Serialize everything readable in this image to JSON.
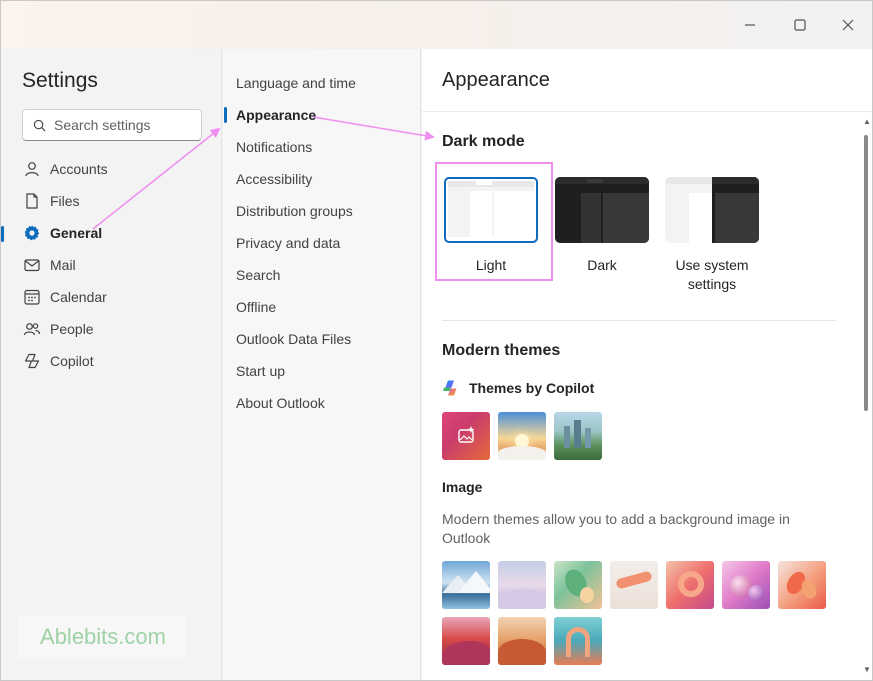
{
  "window": {
    "controls": [
      "minimize",
      "maximize",
      "close"
    ]
  },
  "nav1": {
    "title": "Settings",
    "search_placeholder": "Search settings",
    "items": [
      {
        "label": "Accounts",
        "icon": "person-icon"
      },
      {
        "label": "Files",
        "icon": "file-icon"
      },
      {
        "label": "General",
        "icon": "gear-icon",
        "active": true
      },
      {
        "label": "Mail",
        "icon": "mail-icon"
      },
      {
        "label": "Calendar",
        "icon": "calendar-icon"
      },
      {
        "label": "People",
        "icon": "people-icon"
      },
      {
        "label": "Copilot",
        "icon": "copilot-icon"
      }
    ]
  },
  "nav2": {
    "items": [
      {
        "label": "Language and time"
      },
      {
        "label": "Appearance",
        "active": true
      },
      {
        "label": "Notifications"
      },
      {
        "label": "Accessibility"
      },
      {
        "label": "Distribution groups"
      },
      {
        "label": "Privacy and data"
      },
      {
        "label": "Search"
      },
      {
        "label": "Offline"
      },
      {
        "label": "Outlook Data Files"
      },
      {
        "label": "Start up"
      },
      {
        "label": "About Outlook"
      }
    ]
  },
  "content": {
    "title": "Appearance",
    "dark_mode": {
      "title": "Dark mode",
      "options": [
        {
          "label": "Light",
          "selected": true
        },
        {
          "label": "Dark"
        },
        {
          "label": "Use system settings"
        }
      ]
    },
    "modern_themes": {
      "title": "Modern themes",
      "copilot_label": "Themes by Copilot",
      "image_title": "Image",
      "image_desc": "Modern themes allow you to add a background image in Outlook"
    }
  },
  "logo_text": "Ablebits.com",
  "colors": {
    "accent": "#0f6cbd",
    "annotation": "#f08ef0"
  }
}
